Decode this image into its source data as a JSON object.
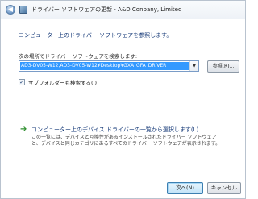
{
  "window": {
    "title": "ドライバー ソフトウェアの更新 - A&D Conpany, Limited"
  },
  "heading": "コンピューター上のドライバー ソフトウェアを参照します。",
  "search": {
    "label": "次の場所でドライバー ソフトウェアを検索します:",
    "path_value": "AD3-DV05-W12,AD3-DV05-W12¥Desktop¥GXA_GFA_DRIVER",
    "browse_label": "参照(R)..."
  },
  "subfolders": {
    "checked": true,
    "check_mark": "✓",
    "label": "サブフォルダーも検索する(I)"
  },
  "pick_option": {
    "icon": "green-arrow-icon",
    "title": "コンピューター上のデバイス ドライバーの一覧から選択します(L)",
    "description": "この一覧には、デバイスと互換性があるインストールされたドライバー ソフトウェアと、デバイスと同じカテゴリにあるすべてのドライバー ソフトウェアが表示されます。"
  },
  "buttons": {
    "next": "次へ(N)",
    "cancel": "キャンセル"
  },
  "colors": {
    "heading": "#163a78",
    "selection": "#3399ff",
    "green_arrow": "#2f8f2f"
  }
}
